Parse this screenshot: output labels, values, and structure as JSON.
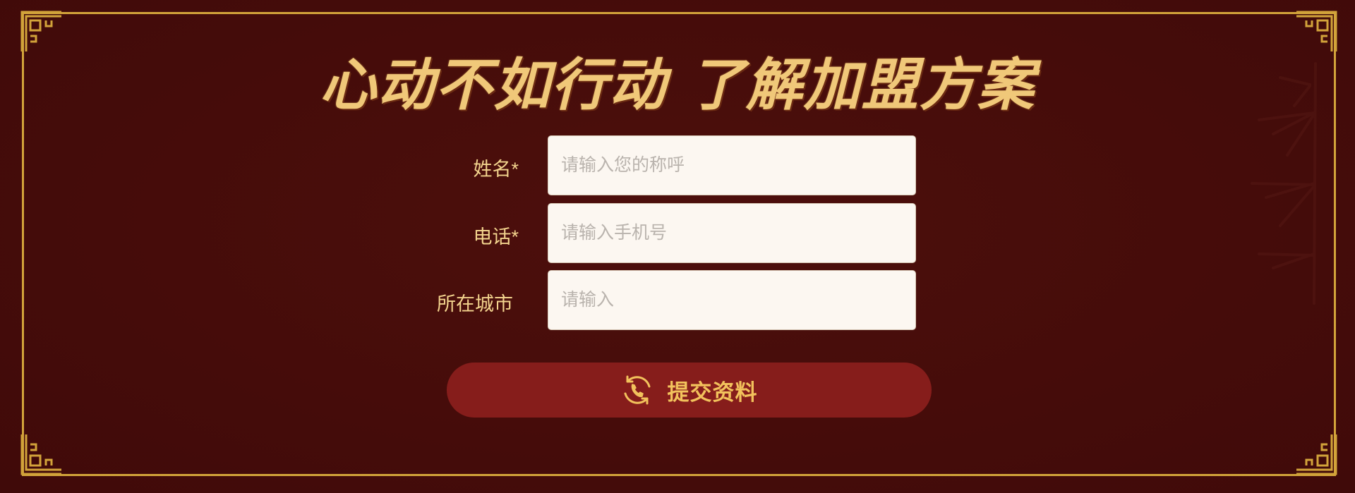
{
  "colors": {
    "background": "#470d0b",
    "gold": "#d2a33a",
    "title": "#f0c879",
    "label": "#f3d48e",
    "input_bg": "#fcf7f1",
    "button_bg": "#861d1b",
    "button_text": "#f2c25c"
  },
  "header": {
    "title": "心动不如行动 了解加盟方案"
  },
  "form": {
    "fields": [
      {
        "label": "姓名*",
        "placeholder": "请输入您的称呼",
        "value": ""
      },
      {
        "label": "电话*",
        "placeholder": "请输入手机号",
        "value": ""
      },
      {
        "label": "所在城市",
        "placeholder": "请输入",
        "value": ""
      }
    ],
    "submit": {
      "icon": "phone-refresh-icon",
      "label": "提交资料"
    }
  }
}
